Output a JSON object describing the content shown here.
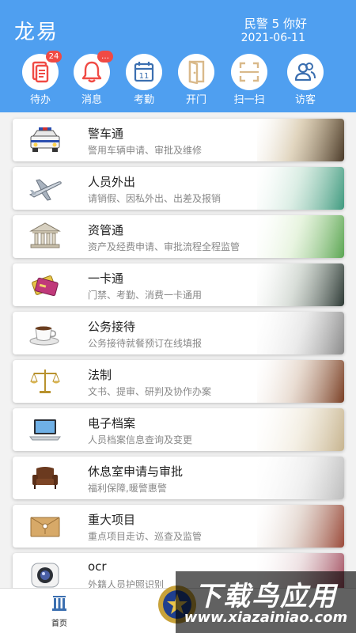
{
  "header": {
    "title": "龙易",
    "greeting": "民警 5 你好",
    "date": "2021-06-11"
  },
  "quick_actions": [
    {
      "label": "待办",
      "icon": "todo-icon",
      "badge": "24"
    },
    {
      "label": "消息",
      "icon": "bell-icon",
      "badge": "…"
    },
    {
      "label": "考勤",
      "icon": "calendar-icon",
      "day": "11"
    },
    {
      "label": "开门",
      "icon": "door-icon"
    },
    {
      "label": "扫一扫",
      "icon": "scan-icon"
    },
    {
      "label": "访客",
      "icon": "visitors-icon"
    }
  ],
  "modules": [
    {
      "title": "警车通",
      "subtitle": "警用车辆申请、审批及维修",
      "icon": "police-car-icon"
    },
    {
      "title": "人员外出",
      "subtitle": "请销假、因私外出、出差及报销",
      "icon": "airplane-icon"
    },
    {
      "title": "资管通",
      "subtitle": "资产及经费申请、审批流程全程监管",
      "icon": "bank-icon"
    },
    {
      "title": "一卡通",
      "subtitle": "门禁、考勤、消费一卡通用",
      "icon": "card-icon"
    },
    {
      "title": "公务接待",
      "subtitle": "公务接待就餐预订在线填报",
      "icon": "coffee-icon"
    },
    {
      "title": "法制",
      "subtitle": "文书、提审、研判及协作办案",
      "icon": "scales-icon"
    },
    {
      "title": "电子档案",
      "subtitle": "人员档案信息查询及变更",
      "icon": "laptop-icon"
    },
    {
      "title": "休息室申请与审批",
      "subtitle": "福利保障,暖警惠警",
      "icon": "armchair-icon"
    },
    {
      "title": "重大项目",
      "subtitle": "重点项目走访、巡查及监管",
      "icon": "envelope-icon"
    },
    {
      "title": "ocr",
      "subtitle": "外籍人员护照识别",
      "icon": "camera-icon"
    }
  ],
  "tabbar": {
    "home_label": "首页"
  },
  "watermark": {
    "main": "下载鸟应用",
    "url": "www.xiazainiao.com"
  },
  "colors": {
    "header_bg": "#4f9ff0",
    "icon_red": "#f04a44",
    "icon_blue": "#3b6fb0",
    "icon_tan": "#d9b98a"
  }
}
